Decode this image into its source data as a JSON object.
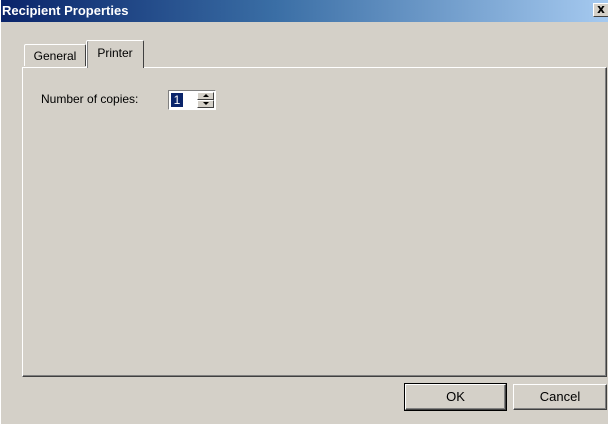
{
  "window": {
    "title": "Recipient Properties",
    "close_label": "x"
  },
  "tabs": [
    {
      "label": "General",
      "selected": false
    },
    {
      "label": "Printer",
      "selected": true
    }
  ],
  "printer": {
    "copies_label": "Number of copies:",
    "copies_value": "1"
  },
  "buttons": {
    "ok_label": "OK",
    "cancel_label": "Cancel"
  },
  "colors": {
    "titlebar_start": "#0a246a",
    "titlebar_end": "#a6caf0",
    "face": "#d4d0c8",
    "selection": "#0a246a"
  }
}
